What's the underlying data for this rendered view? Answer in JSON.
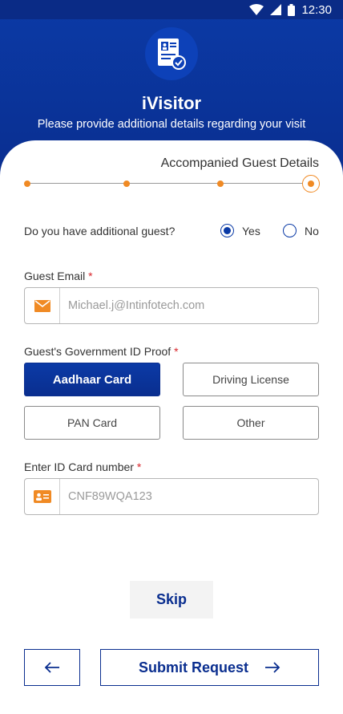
{
  "status_bar": {
    "time": "12:30",
    "icons": [
      "wifi-icon",
      "signal-icon",
      "battery-icon"
    ]
  },
  "header": {
    "logo_icon": "visitor-document-icon",
    "title": "iVisitor",
    "subtitle": "Please provide additional details regarding your visit"
  },
  "stepper": {
    "title": "Accompanied Guest Details",
    "total_steps": 4,
    "current_step": 4
  },
  "guest_question": {
    "label": "Do you have additional guest?",
    "options": [
      {
        "label": "Yes",
        "selected": true
      },
      {
        "label": "No",
        "selected": false
      }
    ]
  },
  "guest_email": {
    "label": "Guest Email",
    "required_mark": "*",
    "placeholder": "Michael.j@Intinfotech.com",
    "icon": "mail-icon"
  },
  "gov_id": {
    "label": "Guest's Government ID Proof",
    "required_mark": "*",
    "options": [
      {
        "label": "Aadhaar Card",
        "selected": true
      },
      {
        "label": "Driving License",
        "selected": false
      },
      {
        "label": "PAN Card",
        "selected": false
      },
      {
        "label": "Other",
        "selected": false
      }
    ]
  },
  "id_number": {
    "label": "Enter ID Card number",
    "required_mark": "*",
    "placeholder": "CNF89WQA123",
    "icon": "id-card-icon"
  },
  "actions": {
    "skip_label": "Skip",
    "back_icon": "arrow-left-icon",
    "submit_label": "Submit Request",
    "submit_icon": "arrow-right-icon"
  },
  "colors": {
    "primary": "#0a2e8f",
    "accent": "#f08a24",
    "required": "#d8262c"
  }
}
